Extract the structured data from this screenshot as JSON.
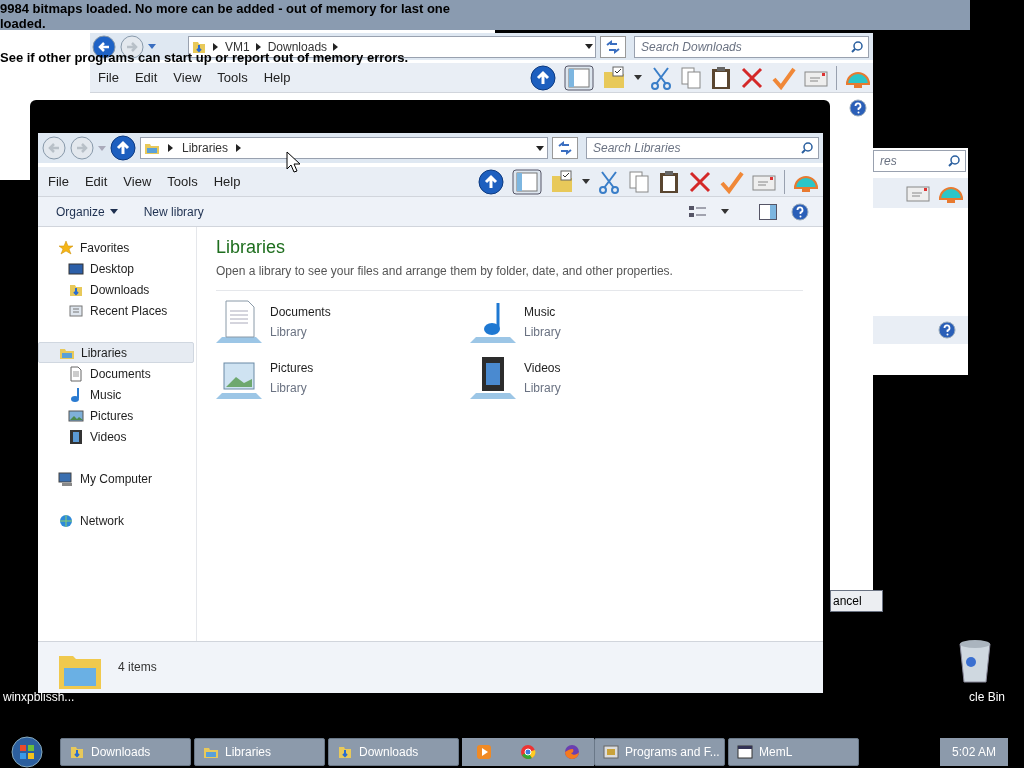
{
  "message_window": {
    "lines": [
      "9984 bitmaps loaded. No more can be added - out of memory for last one loaded.",
      "See if other programs can start up or report out of memory errors."
    ]
  },
  "background_window": {
    "breadcrumb": [
      "VM1",
      "Downloads"
    ],
    "search_placeholder": "Search Downloads",
    "menu": [
      "File",
      "Edit",
      "View",
      "Tools",
      "Help"
    ]
  },
  "partial_window": {
    "search_value": "res",
    "button": "ancel"
  },
  "explorer": {
    "breadcrumb": [
      "Libraries"
    ],
    "search_placeholder": "Search Libraries",
    "menu": [
      "File",
      "Edit",
      "View",
      "Tools",
      "Help"
    ],
    "commands": [
      {
        "label": "Organize",
        "dropdown": true
      },
      {
        "label": "New library",
        "dropdown": false
      }
    ],
    "nav": [
      {
        "label": "Favorites",
        "kind": "star",
        "selected": false,
        "children": [
          {
            "label": "Desktop",
            "kind": "desktop",
            "selected": false
          },
          {
            "label": "Downloads",
            "kind": "download",
            "selected": false
          },
          {
            "label": "Recent Places",
            "kind": "recent",
            "selected": false
          }
        ]
      },
      {
        "label": "Libraries",
        "kind": "library",
        "selected": true,
        "children": [
          {
            "label": "Documents",
            "kind": "document",
            "selected": false
          },
          {
            "label": "Music",
            "kind": "music",
            "selected": false
          },
          {
            "label": "Pictures",
            "kind": "picture",
            "selected": false
          },
          {
            "label": "Videos",
            "kind": "video",
            "selected": false
          }
        ]
      },
      {
        "label": "My Computer",
        "kind": "computer",
        "selected": false
      },
      {
        "label": "Network",
        "kind": "network",
        "selected": false
      }
    ],
    "heading": "Libraries",
    "subtitle": "Open a library to see your files and arrange them by folder, date, and other properties.",
    "items": [
      {
        "name": "Documents",
        "type": "Library",
        "kind": "document"
      },
      {
        "name": "Music",
        "type": "Library",
        "kind": "music"
      },
      {
        "name": "Pictures",
        "type": "Library",
        "kind": "picture"
      },
      {
        "name": "Videos",
        "type": "Library",
        "kind": "video"
      }
    ],
    "status": "4 items"
  },
  "desktop_icons": [
    {
      "label": "winxpblissh...",
      "kind": "image"
    },
    {
      "label": "cle Bin",
      "kind": "recycle"
    }
  ],
  "taskbar": {
    "items": [
      {
        "kind": "downloads",
        "label": "Downloads"
      },
      {
        "kind": "libraries",
        "label": "Libraries"
      },
      {
        "kind": "downloads",
        "label": "Downloads"
      },
      {
        "kind": "player"
      },
      {
        "kind": "browser"
      },
      {
        "kind": "foxbrowser"
      },
      {
        "kind": "programs",
        "label": "Programs and F..."
      },
      {
        "kind": "app",
        "label": "MemL"
      }
    ],
    "clock": "5:02 AM"
  }
}
